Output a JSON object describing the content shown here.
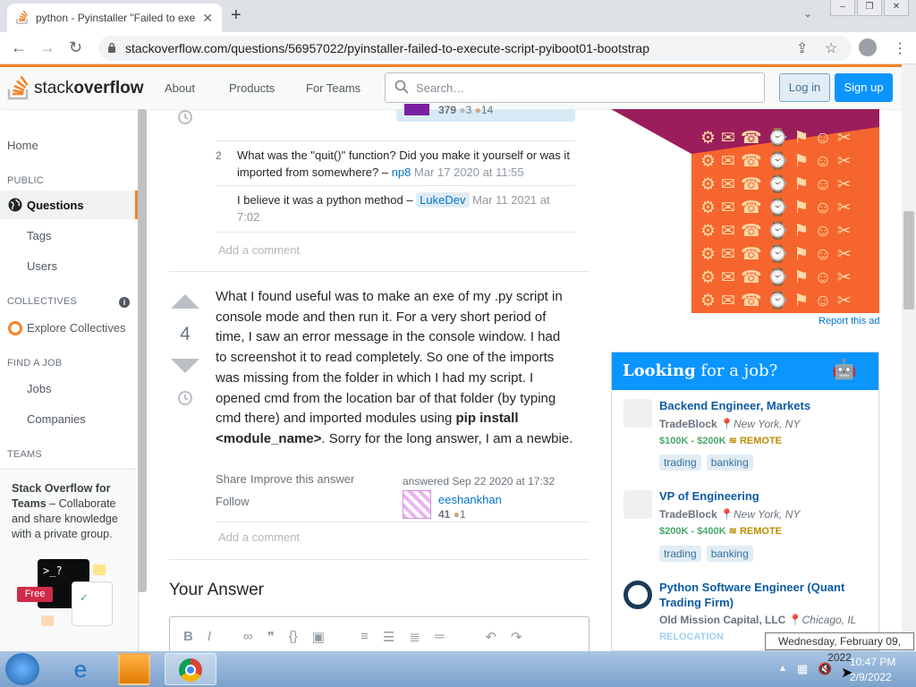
{
  "browser": {
    "tab_title": "python - Pyinstaller \"Failed to exe",
    "url": "stackoverflow.com/questions/56957022/pyinstaller-failed-to-execute-script-pyiboot01-bootstrap",
    "icons": [
      "back-icon",
      "forward-icon",
      "reload-icon",
      "lock-icon",
      "share-icon",
      "star-icon",
      "profile-icon",
      "menu-icon"
    ]
  },
  "header": {
    "logo_text_light": "stack",
    "logo_text_bold": "overflow",
    "nav": [
      "About",
      "Products",
      "For Teams"
    ],
    "search_placeholder": "Search…",
    "login": "Log in",
    "signup": "Sign up"
  },
  "sidebar": {
    "home": "Home",
    "public": "PUBLIC",
    "questions": "Questions",
    "tags": "Tags",
    "users": "Users",
    "collectives": "COLLECTIVES",
    "explore": "Explore Collectives",
    "find_job": "FIND A JOB",
    "jobs": "Jobs",
    "companies": "Companies",
    "teams": "TEAMS",
    "teams_title": "Stack Overflow for Teams",
    "teams_desc": " – Collaborate and share knowledge with a private group.",
    "free_badge": "Free"
  },
  "prev_user": {
    "rep": "379",
    "silver": "3",
    "bronze": "14"
  },
  "comments": [
    {
      "score": "2",
      "text": "What was the \"quit()\" function? Did you make it yourself or was it imported from somewhere? – ",
      "user": "np8",
      "time": "Mar 17 2020 at 11:55"
    },
    {
      "score": "",
      "text": "I believe it was a python method – ",
      "user": "LukeDev",
      "time": "Mar 11 2021 at 7:02"
    }
  ],
  "add_comment": "Add a comment",
  "answer": {
    "votes": "4",
    "body_1": "What I found useful was to make an exe of my .py script in console mode and then run it. For a very short period of time, I saw an error message in the console window. I had to screenshot it to read completely. So one of the imports was missing from the folder in which I had my script. I opened cmd from the location bar of that folder (by typing cmd there) and imported modules using ",
    "body_bold": "pip install <module_name>",
    "body_2": ". Sorry for the long answer, I am a newbie.",
    "share": "Share",
    "improve": "Improve this answer",
    "follow": "Follow",
    "answered": "answered Sep 22 2020 at 17:32",
    "user": "eeshankhan",
    "rep": "41",
    "bronze": "1"
  },
  "your_answer": "Your Answer",
  "ad": {
    "report": "Report this ad"
  },
  "jobs": {
    "heading_bold": "Looking",
    "heading_rest": " for a job?",
    "items": [
      {
        "title": "Backend Engineer, Markets",
        "company": "TradeBlock",
        "location": "New York, NY",
        "salary": "$100K - $200K",
        "remote": "REMOTE",
        "tags": [
          "trading",
          "banking"
        ]
      },
      {
        "title": "VP of Engineering",
        "company": "TradeBlock",
        "location": "New York, NY",
        "salary": "$200K - $400K",
        "remote": "REMOTE",
        "tags": [
          "trading",
          "banking"
        ]
      },
      {
        "title": "Python Software Engineer (Quant Trading Firm)",
        "company": "Old Mission Capital, LLC",
        "location": "Chicago, IL",
        "extra": "RELOCATION",
        "tags": []
      }
    ]
  },
  "taskbar": {
    "time": "10:47 PM",
    "date": "2/9/2022",
    "tooltip": "Wednesday, February 09, 2022"
  },
  "colors": {
    "accent": "#f48225",
    "blue": "#0a95ff",
    "ad_orange": "#f6652d",
    "ad_magenta": "#9c1d5b"
  }
}
